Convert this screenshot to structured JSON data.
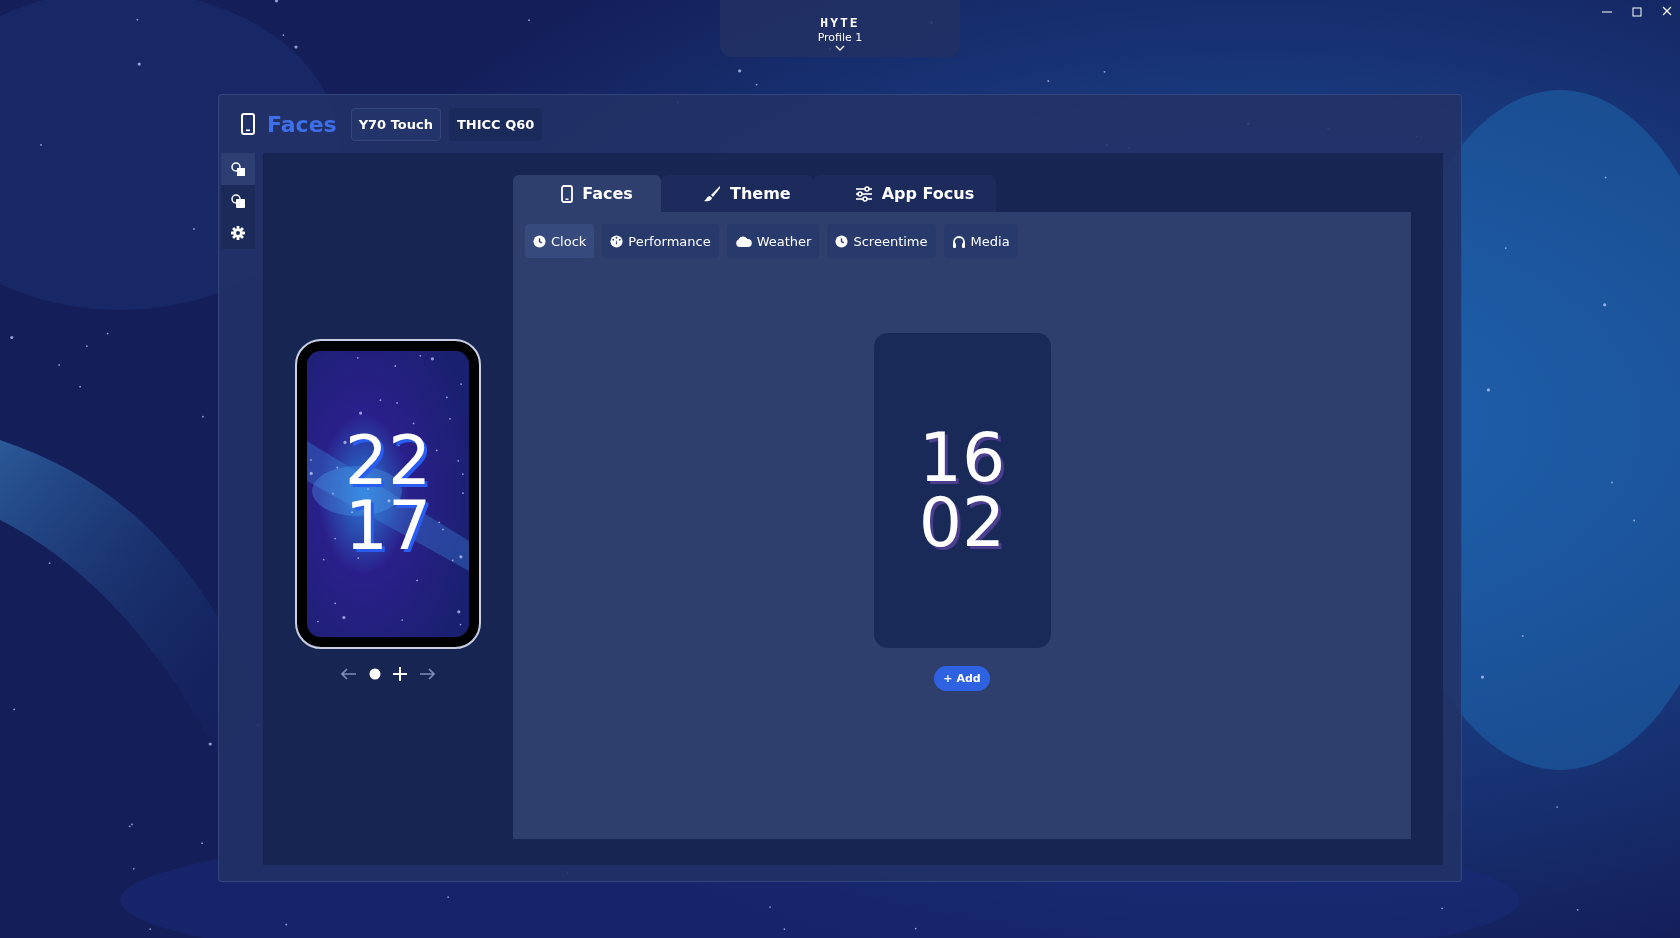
{
  "brand": "HYTE",
  "profile": {
    "name": "Profile 1"
  },
  "header": {
    "title": "Faces",
    "devices": [
      {
        "label": "Y70 Touch",
        "selected": true
      },
      {
        "label": "THICC Q60",
        "selected": false
      }
    ]
  },
  "sidebar": {
    "items": [
      {
        "kind": "faces",
        "selected": true
      },
      {
        "kind": "layers",
        "selected": false
      },
      {
        "kind": "settings",
        "selected": false
      }
    ]
  },
  "preview": {
    "time": [
      "22",
      "17"
    ],
    "pages": [
      {
        "selected": true
      }
    ]
  },
  "tabs": [
    {
      "label": "Faces",
      "kind": "phone",
      "selected": true
    },
    {
      "label": "Theme",
      "kind": "brush",
      "selected": false
    },
    {
      "label": "App Focus",
      "kind": "sliders",
      "selected": false
    }
  ],
  "categories": [
    {
      "label": "Clock",
      "kind": "clock",
      "selected": true
    },
    {
      "label": "Performance",
      "kind": "gauge",
      "selected": false
    },
    {
      "label": "Weather",
      "kind": "cloud",
      "selected": false
    },
    {
      "label": "Screentime",
      "kind": "clock",
      "selected": false
    },
    {
      "label": "Media",
      "kind": "headphones",
      "selected": false
    }
  ],
  "faces": [
    {
      "time": [
        "16",
        "02"
      ]
    }
  ],
  "add_button": "+ Add"
}
